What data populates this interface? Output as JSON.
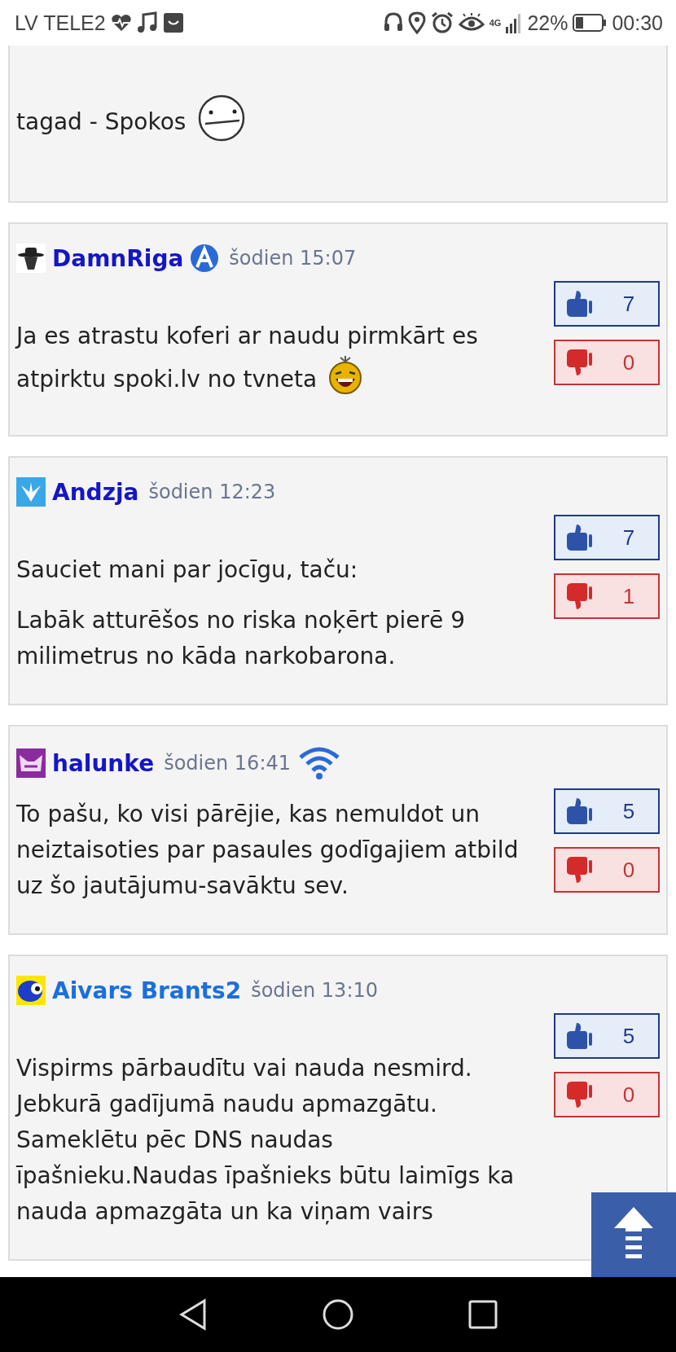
{
  "status_bar": {
    "carrier": "LV TELE2",
    "network": "4G",
    "battery": "22%",
    "time": "00:30"
  },
  "partial_comment": {
    "paragraphs": [
      {
        "text": "tagad - Spokos",
        "emoji": {
          "kind": "poker-face"
        }
      }
    ]
  },
  "comments": [
    {
      "avatar": {
        "kind": "hat"
      },
      "author": "DamnRiga",
      "color": "#1515c8",
      "badge": {
        "kind": "emblem"
      },
      "time": "šodien 15:07",
      "paragraphs": [
        {
          "text": "Ja es atrastu koferi ar naudu pirmkārt es atpirktu spoki.lv no tvneta",
          "emoji": {
            "kind": "laughing"
          }
        }
      ],
      "likes": "7",
      "dislikes": "0"
    },
    {
      "avatar": {
        "kind": "dove"
      },
      "author": "Andzja",
      "color": "#1515c8",
      "time": "šodien 12:23",
      "paragraphs": [
        {
          "text": "Sauciet mani par jocīgu, taču:"
        },
        {
          "text": "Labāk atturēšos no riska noķērt pierē 9 milimetrus no kāda narkobarona."
        }
      ],
      "likes": "7",
      "dislikes": "1"
    },
    {
      "avatar": {
        "kind": "mask"
      },
      "author": "halunke",
      "color": "#1515c8",
      "time": "šodien 16:41",
      "time_icon": {
        "kind": "wifi"
      },
      "paragraphs": [
        {
          "text": "To pašu, ko visi pārējie, kas nemuldot un neiztaisoties par pasaules godīgajiem atbild uz šo jautājumu-savāktu sev."
        }
      ],
      "likes": "5",
      "dislikes": "0"
    },
    {
      "avatar": {
        "kind": "blob"
      },
      "author": "Aivars Brants2",
      "color": "#1a6fe0",
      "time": "šodien 13:10",
      "paragraphs": [
        {
          "text": "Vispirms pārbaudītu vai nauda nesmird. Jebkurā gadījumā naudu apmazgātu. Sameklētu pēc DNS naudas īpašnieku.Naudas īpašnieks būtu laimīgs ka nauda apmazgāta un ka viņam vairs"
        }
      ],
      "likes": "5",
      "dislikes": "0"
    }
  ]
}
